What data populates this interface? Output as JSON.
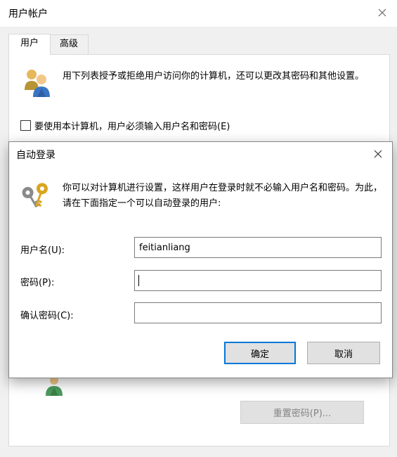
{
  "parent": {
    "title": "用户帐户",
    "tabs": [
      {
        "label": "用户"
      },
      {
        "label": "高级"
      }
    ],
    "description": "用下列表授予或拒绝用户访问你的计算机，还可以更改其密码和其他设置。",
    "require_login_label": "要使用本计算机，用户必须输入用户名和密码(E)",
    "require_login_checked": false,
    "reset_password_label": "重置密码(P)..."
  },
  "dialog": {
    "title": "自动登录",
    "description": "你可以对计算机进行设置，这样用户在登录时就不必输入用户名和密码。为此，请在下面指定一个可以自动登录的用户:",
    "fields": {
      "username": {
        "label": "用户名(U):",
        "value": "feitianliang"
      },
      "password": {
        "label": "密码(P):",
        "value": ""
      },
      "confirm": {
        "label": "确认密码(C):",
        "value": ""
      }
    },
    "ok_label": "确定",
    "cancel_label": "取消"
  },
  "colors": {
    "focus_border": "#0078d7",
    "window_bg": "#f0f0f0",
    "button_bg": "#e1e1e1",
    "disabled_text": "#838383"
  },
  "icons": {
    "parent_close": "close-icon",
    "dialog_close": "close-icon",
    "users": "users-icon",
    "keys": "keys-icon"
  }
}
